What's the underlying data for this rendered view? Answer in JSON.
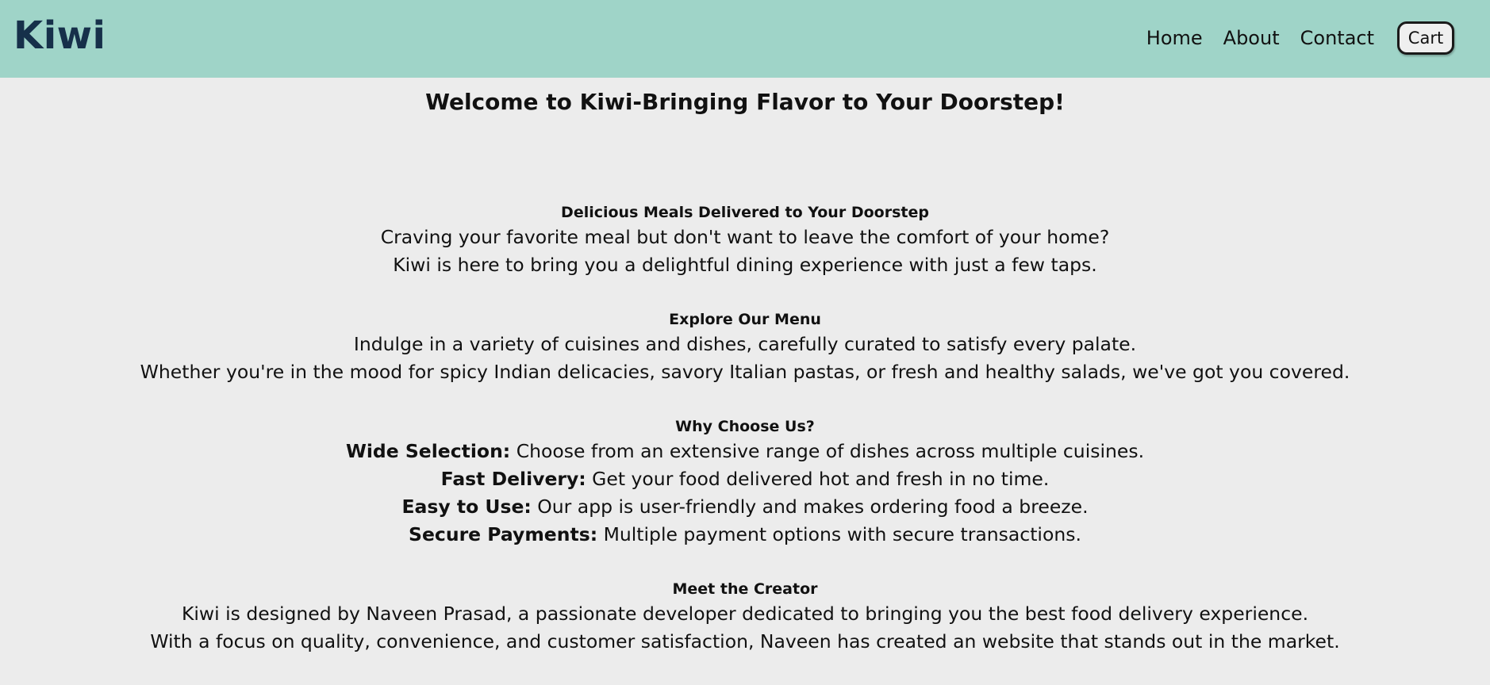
{
  "header": {
    "logo": "Kiwi",
    "nav": [
      "Home",
      "About",
      "Contact"
    ],
    "cart_label": "Cart"
  },
  "main": {
    "title": "Welcome to Kiwi-Bringing Flavor to Your Doorstep!",
    "sections": [
      {
        "heading": "Delicious Meals Delivered to Your Doorstep",
        "lines": [
          "Craving your favorite meal but don't want to leave the comfort of your home?",
          "Kiwi is here to bring you a delightful dining experience with just a few taps."
        ]
      },
      {
        "heading": "Explore Our Menu",
        "lines": [
          "Indulge in a variety of cuisines and dishes, carefully curated to satisfy every palate.",
          "Whether you're in the mood for spicy Indian delicacies, savory Italian pastas, or fresh and healthy salads, we've got you covered."
        ]
      },
      {
        "heading": "Why Choose Us?",
        "features": [
          {
            "label": "Wide Selection:",
            "text": " Choose from an extensive range of dishes across multiple cuisines."
          },
          {
            "label": "Fast Delivery:",
            "text": " Get your food delivered hot and fresh in no time."
          },
          {
            "label": "Easy to Use:",
            "text": " Our app is user-friendly and makes ordering food a breeze."
          },
          {
            "label": "Secure Payments:",
            "text": " Multiple payment options with secure transactions."
          }
        ]
      },
      {
        "heading": "Meet the Creator",
        "lines": [
          "Kiwi is designed by Naveen Prasad, a passionate developer dedicated to bringing you the best food delivery experience.",
          "With a focus on quality, convenience, and customer satisfaction, Naveen has created an website that stands out in the market."
        ]
      }
    ]
  },
  "colors": {
    "header_bg": "#9fd4c8",
    "page_bg": "#ececec",
    "logo": "#16304a"
  }
}
